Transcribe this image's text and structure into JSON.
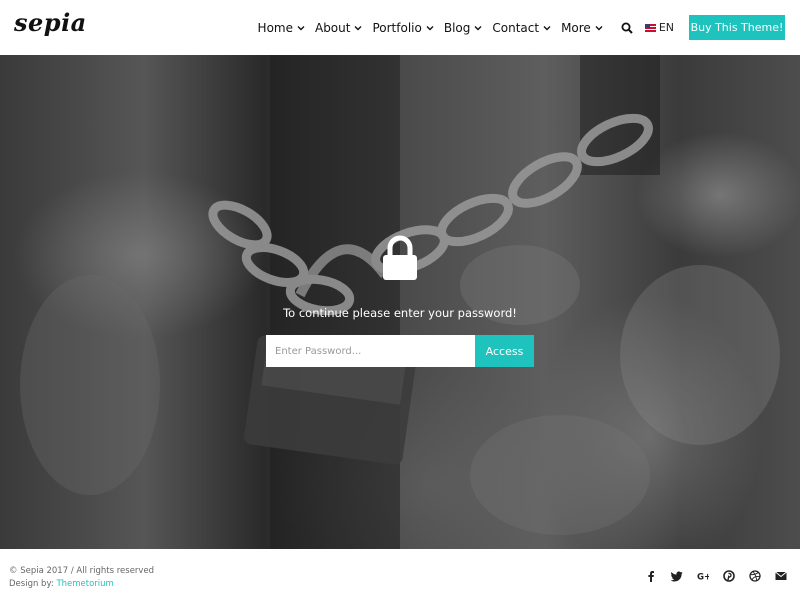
{
  "header": {
    "logo": "sepia",
    "nav": [
      {
        "label": "Home"
      },
      {
        "label": "About"
      },
      {
        "label": "Portfolio"
      },
      {
        "label": "Blog"
      },
      {
        "label": "Contact"
      },
      {
        "label": "More"
      }
    ],
    "search_icon": "search-icon",
    "language": "EN",
    "buy_button": "Buy This Theme!"
  },
  "hero": {
    "lock_icon": "padlock-icon",
    "message": "To continue please enter your password!",
    "password_placeholder": "Enter Password...",
    "password_value": "",
    "access_button": "Access"
  },
  "footer": {
    "copyright": "© Sepia 2017 / All rights reserved",
    "design_by_label": "Design by:",
    "design_by_link": "Themetorium",
    "social_icons": [
      "facebook-icon",
      "twitter-icon",
      "google-plus-icon",
      "pinterest-icon",
      "dribbble-icon",
      "email-icon"
    ]
  },
  "colors": {
    "accent": "#1fc3bd",
    "text": "#111111",
    "footer_text": "#666666"
  }
}
